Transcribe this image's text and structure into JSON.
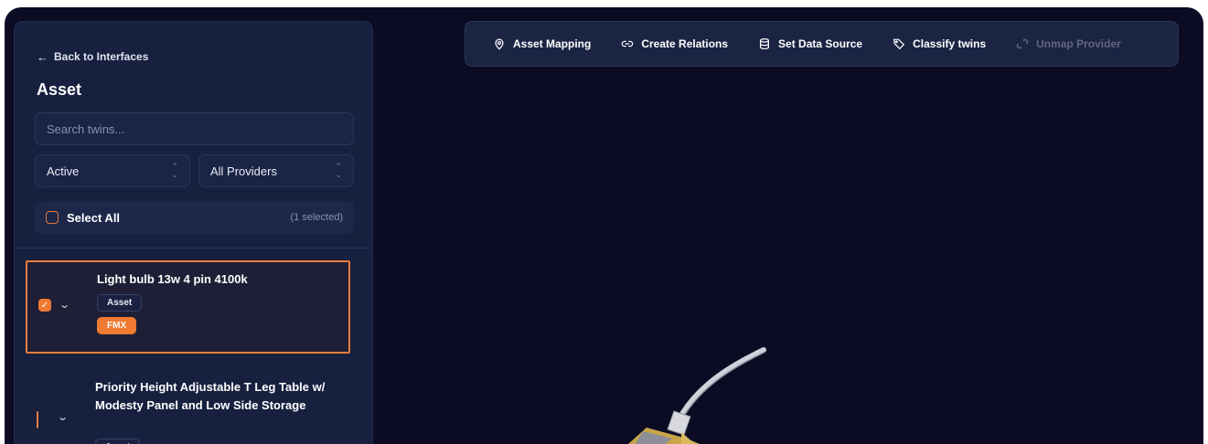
{
  "sidebar": {
    "back_label": "Back to Interfaces",
    "title": "Asset",
    "search": {
      "placeholder": "Search twins..."
    },
    "status_filter": {
      "value": "Active"
    },
    "provider_filter": {
      "value": "All Providers"
    },
    "select_all_label": "Select All",
    "selected_count": "(1 selected)",
    "items": [
      {
        "name": "Light bulb 13w 4 pin 4100k",
        "type": "Asset",
        "provider": "FMX",
        "checked": true
      },
      {
        "name": "Priority Height Adjustable T Leg Table w/ Modesty Panel and Low Side Storage",
        "type": "Asset",
        "checked": false
      }
    ]
  },
  "toolbar": {
    "asset_mapping": "Asset Mapping",
    "create_relations": "Create Relations",
    "set_data_source": "Set Data Source",
    "classify_twins": "Classify twins",
    "unmap_provider": "Unmap Provider"
  },
  "icons": {
    "back": "arrow-left-icon",
    "asset_mapping": "map-pin-icon",
    "create_relations": "link-icon",
    "set_data_source": "database-icon",
    "classify_twins": "tag-icon",
    "unmap_provider": "unlink-icon",
    "select": "chevron-up-down-icon",
    "expand": "chevron-down-icon"
  },
  "colors": {
    "background": "#0b0c24",
    "panel": "#17203f",
    "accent": "#ef7a31",
    "disabled_text": "#5f6680"
  }
}
